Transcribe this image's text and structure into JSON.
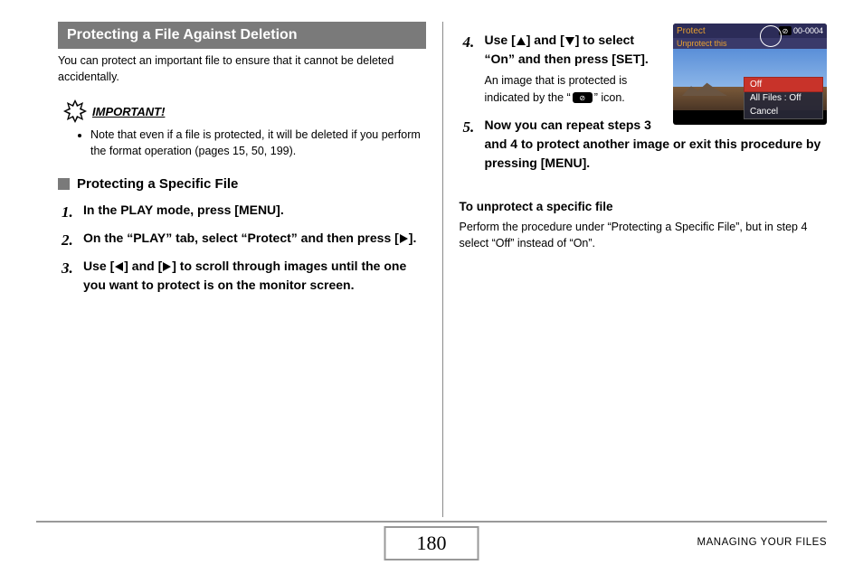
{
  "heading": "Protecting a File Against Deletion",
  "intro": "You can protect an important file to ensure that it cannot be deleted accidentally.",
  "important_label": "IMPORTANT!",
  "important_note": "Note that even if a file is protected, it will be deleted if you perform the format operation (pages 15, 50, 199).",
  "subheading1": "Protecting a Specific File",
  "steps_left": {
    "s1": "In the PLAY mode, press [MENU].",
    "s2_a": "On the “PLAY” tab, select “Protect” and then press [",
    "s2_b": "].",
    "s3_a": "Use [",
    "s3_b": "] and [",
    "s3_c": "] to scroll through images until the one you want to protect is on the monitor screen."
  },
  "steps_right": {
    "s4_a": "Use [",
    "s4_b": "] and [",
    "s4_c": "] to select “On” and then press [SET].",
    "s4_sub_a": "An image that is protected is indicated by the “",
    "s4_sub_b": "” icon.",
    "s5": "Now you can repeat steps 3 and 4 to protect another image or exit this procedure by pressing [MENU]."
  },
  "screen": {
    "title": "Protect",
    "sub": "Unprotect this",
    "count": "00-0004",
    "menu": {
      "opt1": "Off",
      "opt2": "All Files : Off",
      "opt3": "Cancel"
    }
  },
  "unprotect_head": "To unprotect a specific file",
  "unprotect_body": "Perform the procedure under “Protecting a Specific File”, but in step 4 select “Off” instead of “On”.",
  "page_number": "180",
  "chapter": "MANAGING YOUR FILES"
}
